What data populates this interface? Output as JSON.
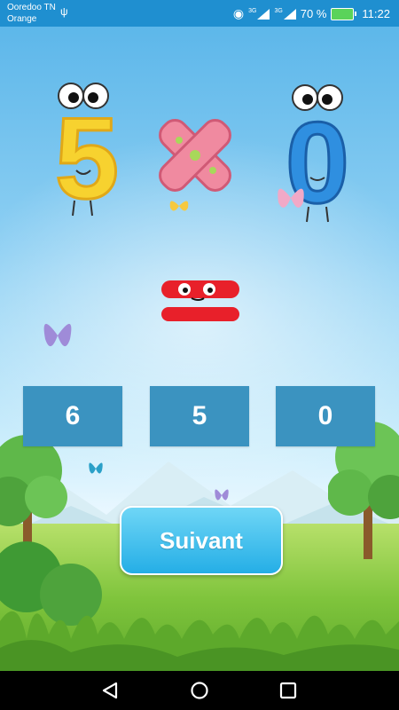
{
  "status_bar": {
    "carrier_1": "Ooredoo TN",
    "carrier_2": "Orange",
    "network_1": "3G",
    "network_2": "3G",
    "battery": "70 %",
    "time": "11:22",
    "icons": [
      "usb-icon",
      "eye-icon",
      "signal-icon",
      "battery-icon"
    ]
  },
  "equation": {
    "operand_1": "5",
    "operator": "×",
    "operand_2": "0",
    "equals": "="
  },
  "answers": [
    {
      "label": "6"
    },
    {
      "label": "5"
    },
    {
      "label": "0"
    }
  ],
  "next_button": {
    "label": "Suivant"
  },
  "nav_bar": {
    "icons": [
      "back-icon",
      "home-icon",
      "recents-icon"
    ]
  },
  "colors": {
    "status_bar": "#1f8fd0",
    "answer_box": "#3b93c0",
    "button": "#25aee6",
    "digit_five": "#f7d22f",
    "digit_zero": "#2f8fe0",
    "multiply": "#f08aa0"
  }
}
